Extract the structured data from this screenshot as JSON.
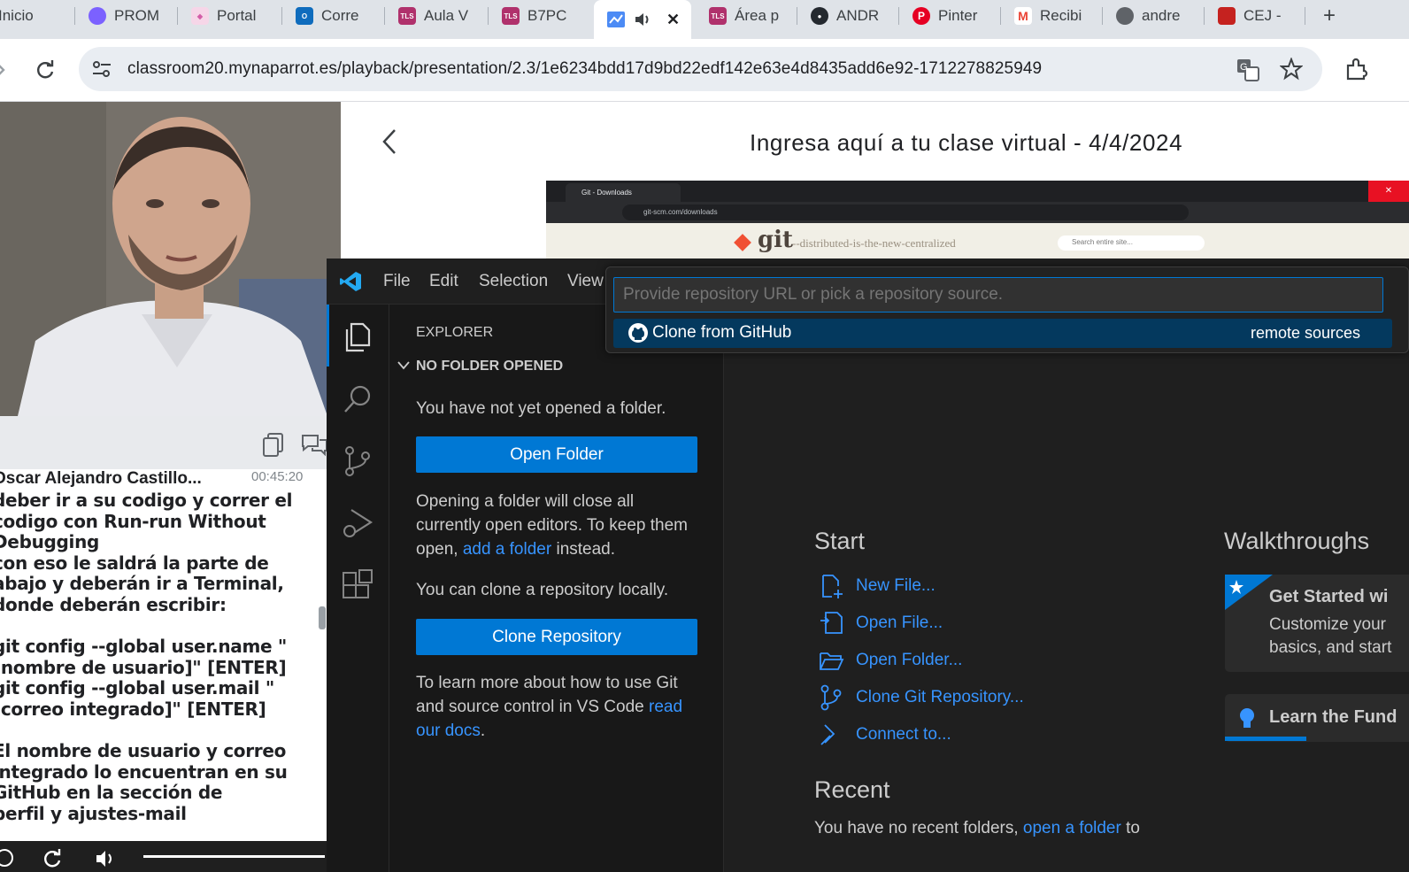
{
  "browser": {
    "tabs": [
      {
        "title": "Inicio",
        "fav_color": "#5f6368"
      },
      {
        "title": "PROM",
        "fav_color": "#7b61ff"
      },
      {
        "title": "Portal",
        "fav_color": "#d35ea8"
      },
      {
        "title": "Corre",
        "fav_color": "#0f6cbd"
      },
      {
        "title": "Aula V",
        "fav_color": "#b0316c"
      },
      {
        "title": "B7PC",
        "fav_color": "#b0316c"
      },
      {
        "title": "Área p",
        "fav_color": "#b0316c"
      },
      {
        "title": "ANDR",
        "fav_color": "#24292f"
      },
      {
        "title": "Pinter",
        "fav_color": "#e60023"
      },
      {
        "title": "Recibi",
        "fav_color": "#ea4335"
      },
      {
        "title": "andre",
        "fav_color": "#5f6368"
      },
      {
        "title": "CEJ -",
        "fav_color": "#c5221f"
      }
    ],
    "fav_badge": "TLS",
    "new_tab": "+",
    "active_tab_close": "✕",
    "url": "classroom20.mynaparrot.es/playback/presentation/2.3/1e6234bdd17d9bd22edf142e63e4d8435add6e92-1712278825949"
  },
  "chat": {
    "author": "Oscar Alejandro Castillo...",
    "time": "00:45:20",
    "message": "deber ir a su codigo y correr el\ncodigo con Run-run Without\nDebugging\ncon eso le saldrá la parte de\nabajo y deberán ir a Terminal,\ndonde deberán escribir:\n\ngit config --global user.name \"\n[nombre de usuario]\" [ENTER]\ngit config --global user.mail \"\n[correo integrado]\" [ENTER]\n\nEl nombre de usuario y correo\nintegrado lo encuentran en su\nGitHub en la sección de\nperfil y ajustes-mail"
  },
  "presentation": {
    "title": "Ingresa aquí a tu clase virtual - 4/4/2024",
    "shot_tab": "Git - Downloads",
    "shot_url": "git-scm.com/downloads",
    "shot_logo": "git",
    "shot_tagline": "--distributed-is-the-new-centralized",
    "shot_search": "Search entire site..."
  },
  "vscode": {
    "menu": [
      "File",
      "Edit",
      "Selection",
      "View"
    ],
    "explorer_title": "EXPLORER",
    "no_folder": "NO FOLDER OPENED",
    "not_opened": "You have not yet opened a folder.",
    "open_folder_btn": "Open Folder",
    "opening_text_1": "Opening a folder will close all",
    "opening_text_2": "currently open editors. To keep them",
    "opening_text_3a": "open, ",
    "opening_link": "add a folder",
    "opening_text_3b": " instead.",
    "clone_text": "You can clone a repository locally.",
    "clone_btn": "Clone Repository",
    "learn_1": "To learn more about how to use Git",
    "learn_2a": "and source control in VS Code ",
    "learn_link_a": "read",
    "learn_link_b": "our docs",
    "learn_end": ".",
    "quick_pick": {
      "placeholder": "Provide repository URL or pick a repository source.",
      "item_label": "Clone from GitHub",
      "item_detail": "remote sources"
    },
    "start": {
      "heading": "Start",
      "items": [
        "New File...",
        "Open File...",
        "Open Folder...",
        "Clone Git Repository...",
        "Connect to..."
      ]
    },
    "recent": {
      "heading": "Recent",
      "text_a": "You have no recent folders, ",
      "link": "open a folder",
      "text_b": " to"
    },
    "walkthroughs": {
      "heading": "Walkthroughs",
      "card1_title": "Get Started wi",
      "card1_line1": "Customize your",
      "card1_line2": "basics, and start",
      "card2_title": "Learn the Fund"
    }
  }
}
